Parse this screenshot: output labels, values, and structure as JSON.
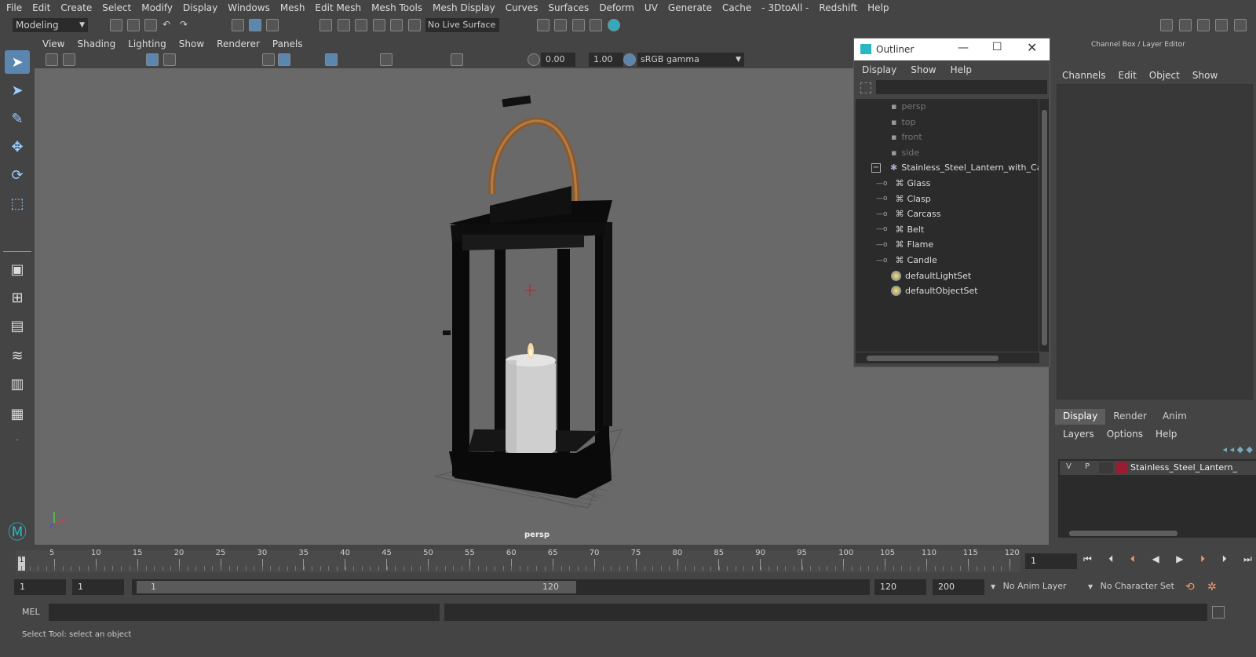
{
  "menubar": [
    "File",
    "Edit",
    "Create",
    "Select",
    "Modify",
    "Display",
    "Windows",
    "Mesh",
    "Edit Mesh",
    "Mesh Tools",
    "Mesh Display",
    "Curves",
    "Surfaces",
    "Deform",
    "UV",
    "Generate",
    "Cache",
    "- 3DtoAll -",
    "Redshift",
    "Help"
  ],
  "toolbar": {
    "mode": "Modeling",
    "live_surface": "No Live Surface"
  },
  "viewport_menu": [
    "View",
    "Shading",
    "Lighting",
    "Show",
    "Renderer",
    "Panels"
  ],
  "viewport_toolbar": {
    "exposure": "0.00",
    "gamma": "1.00",
    "colorspace": "sRGB gamma"
  },
  "viewport": {
    "camera_label": "persp"
  },
  "outliner": {
    "title": "Outliner",
    "menu": [
      "Display",
      "Show",
      "Help"
    ],
    "cameras": [
      "persp",
      "top",
      "front",
      "side"
    ],
    "group": "Stainless_Steel_Lantern_with_Can",
    "children": [
      "Glass",
      "Clasp",
      "Carcass",
      "Belt",
      "Flame",
      "Candle"
    ],
    "sets": [
      "defaultLightSet",
      "defaultObjectSet"
    ]
  },
  "channel_box": {
    "title": "Channel Box / Layer Editor",
    "menu": [
      "Channels",
      "Edit",
      "Object",
      "Show"
    ],
    "tabs": [
      "Display",
      "Render",
      "Anim"
    ],
    "layer_menu": [
      "Layers",
      "Options",
      "Help"
    ],
    "layer": {
      "v": "V",
      "p": "P",
      "name": "Stainless_Steel_Lantern_",
      "color": "#9b1b30"
    }
  },
  "timeline": {
    "ticks": [
      "5",
      "10",
      "15",
      "20",
      "25",
      "30",
      "35",
      "40",
      "45",
      "50",
      "55",
      "60",
      "65",
      "70",
      "75",
      "80",
      "85",
      "90",
      "95",
      "100",
      "105",
      "110",
      "115",
      "120"
    ],
    "current_frame": "1",
    "frame_marker": "1"
  },
  "range": {
    "start": "1",
    "start2": "1",
    "slider_start": "1",
    "slider_end": "120",
    "end": "120",
    "end2": "200",
    "anim_layer": "No Anim Layer",
    "char_set": "No Character Set"
  },
  "mel": {
    "label": "MEL"
  },
  "status": {
    "text": "Select Tool: select an object"
  }
}
